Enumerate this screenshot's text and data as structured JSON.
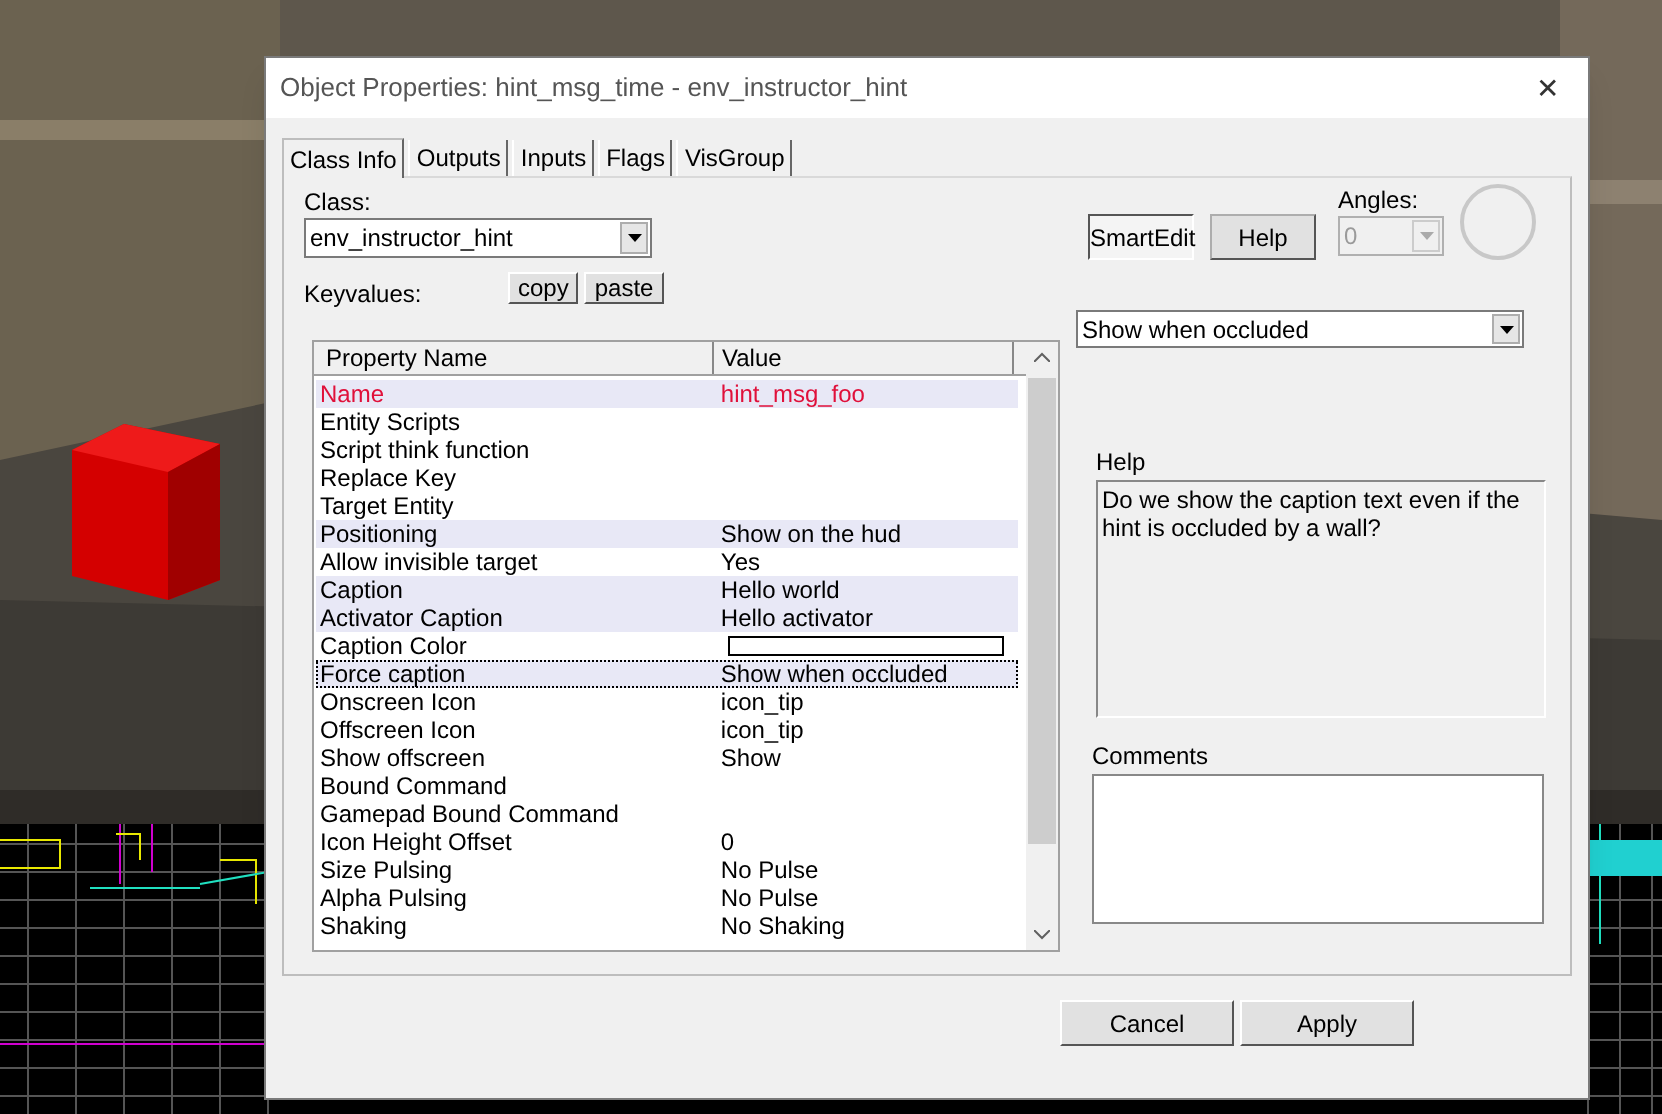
{
  "window": {
    "title": "Object Properties: hint_msg_time - env_instructor_hint",
    "close": "✕"
  },
  "tabs": [
    {
      "label": "Class Info",
      "selected": true
    },
    {
      "label": "Outputs",
      "selected": false
    },
    {
      "label": "Inputs",
      "selected": false
    },
    {
      "label": "Flags",
      "selected": false
    },
    {
      "label": "VisGroup",
      "selected": false
    }
  ],
  "class": {
    "label": "Class:",
    "value": "env_instructor_hint"
  },
  "keyvalues": {
    "label": "Keyvalues:",
    "buttons": [
      "copy",
      "paste"
    ]
  },
  "smartedit": {
    "label": "SmartEdit",
    "pressed": true
  },
  "help_button": "Help",
  "angles": {
    "label": "Angles:",
    "value": "0",
    "disabled": true
  },
  "properties": {
    "columns": [
      "Property Name",
      "Value"
    ],
    "rows": [
      {
        "name": "Name",
        "value": "hint_msg_foo",
        "kind": "key",
        "highlighted": true,
        "selected": false
      },
      {
        "name": "Entity Scripts",
        "kind": "text",
        "highlighted": false,
        "selected": false
      },
      {
        "name": "Script think function",
        "kind": "text",
        "highlighted": false,
        "selected": false
      },
      {
        "name": "Replace Key",
        "kind": "text",
        "highlighted": false,
        "selected": false
      },
      {
        "name": "Target Entity",
        "kind": "text",
        "highlighted": false,
        "selected": false
      },
      {
        "name": "Positioning",
        "value": "Show on the hud",
        "kind": "text",
        "highlighted": true,
        "selected": false
      },
      {
        "name": "Allow invisible target",
        "value": "Yes",
        "kind": "text",
        "highlighted": false,
        "selected": false
      },
      {
        "name": "Caption",
        "value": "Hello world",
        "kind": "text",
        "highlighted": true,
        "selected": false
      },
      {
        "name": "Activator Caption",
        "value": "Hello activator",
        "kind": "text",
        "highlighted": true,
        "selected": false
      },
      {
        "name": "Caption Color",
        "kind": "swatch",
        "highlighted": false,
        "selected": false
      },
      {
        "name": "Force caption",
        "value": "Show when occluded",
        "kind": "text",
        "highlighted": true,
        "selected": true
      },
      {
        "name": "Onscreen Icon",
        "value": "icon_tip",
        "kind": "text",
        "highlighted": false,
        "selected": false
      },
      {
        "name": "Offscreen Icon",
        "value": "icon_tip",
        "kind": "text",
        "highlighted": false,
        "selected": false
      },
      {
        "name": "Show offscreen",
        "value": "Show",
        "kind": "text",
        "highlighted": false,
        "selected": false
      },
      {
        "name": "Bound Command",
        "kind": "text",
        "highlighted": false,
        "selected": false
      },
      {
        "name": "Gamepad Bound Command",
        "kind": "text",
        "highlighted": false,
        "selected": false
      },
      {
        "name": "Icon Height Offset",
        "value": "0",
        "kind": "text",
        "highlighted": false,
        "selected": false
      },
      {
        "name": "Size Pulsing",
        "value": "No Pulse",
        "kind": "text",
        "highlighted": false,
        "selected": false
      },
      {
        "name": "Alpha Pulsing",
        "value": "No Pulse",
        "kind": "text",
        "highlighted": false,
        "selected": false
      },
      {
        "name": "Shaking",
        "value": "No Shaking",
        "kind": "text",
        "highlighted": false,
        "selected": false
      }
    ]
  },
  "value_dropdown": {
    "value": "Show when occluded"
  },
  "help": {
    "label": "Help",
    "text": "Do we show the caption text even if the hint is occluded by a wall?"
  },
  "comments": {
    "label": "Comments"
  },
  "buttons": [
    "Cancel",
    "Apply"
  ]
}
